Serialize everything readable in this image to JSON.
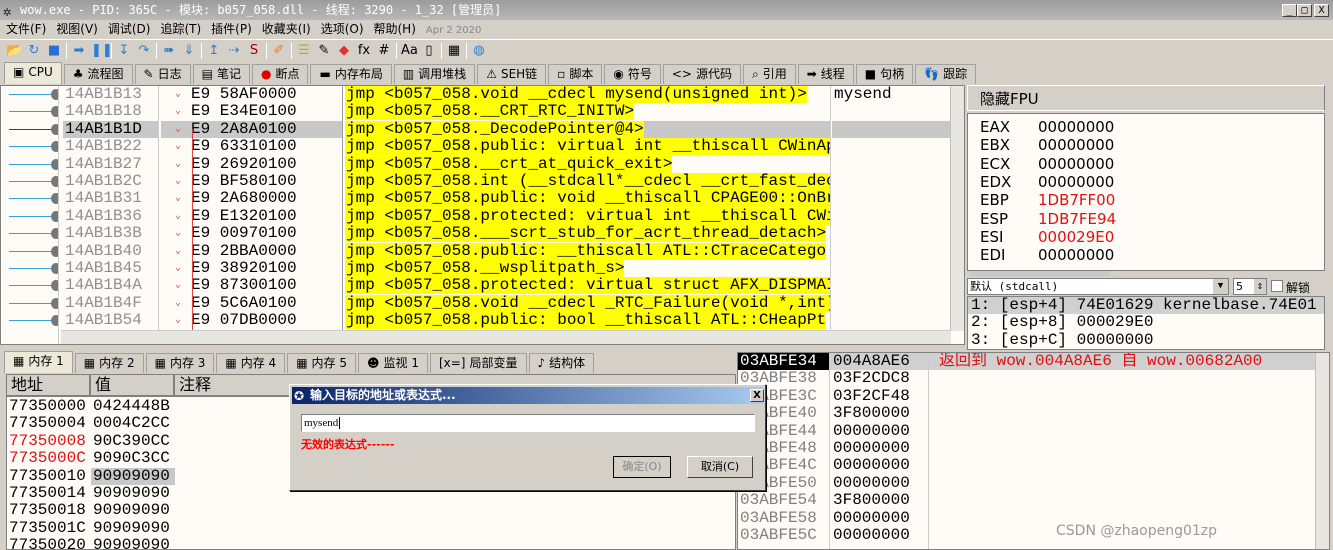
{
  "title": "wow.exe - PID: 365C - 模块: b057_058.dll - 线程: 3290 - 1_32 [管理员]",
  "window_buttons": {
    "minimize": "_",
    "maximize": "□",
    "close": "X"
  },
  "menu": [
    "文件(F)",
    "视图(V)",
    "调试(D)",
    "追踪(T)",
    "插件(P)",
    "收藏夹(I)",
    "选项(O)",
    "帮助(H)"
  ],
  "menu_date": "Apr 2 2020",
  "toolbar_icons": [
    "open-icon",
    "restart-icon",
    "stop-icon",
    "run-icon",
    "pause-icon",
    "step-into-icon",
    "step-over-icon",
    "trace-into-icon",
    "trace-over-icon",
    "execute-till-return-icon",
    "run-to-user-code-icon",
    "scylla-icon",
    "patch-icon",
    "comment-icon",
    "label-icon",
    "bookmark-icon",
    "function-icon",
    "hash-icon",
    "font-icon",
    "device-icon",
    "calculator-icon",
    "globe-icon"
  ],
  "main_tabs": [
    {
      "icon": "▣",
      "label": "CPU"
    },
    {
      "icon": "♣",
      "label": "流程图"
    },
    {
      "icon": "✎",
      "label": "日志"
    },
    {
      "icon": "▤",
      "label": "笔记"
    },
    {
      "icon": "●",
      "label": "断点"
    },
    {
      "icon": "▬",
      "label": "内存布局"
    },
    {
      "icon": "▥",
      "label": "调用堆栈"
    },
    {
      "icon": "⚠",
      "label": "SEH链"
    },
    {
      "icon": "▫",
      "label": "脚本"
    },
    {
      "icon": "◉",
      "label": "符号"
    },
    {
      "icon": "<>",
      "label": "源代码"
    },
    {
      "icon": "⌕",
      "label": "引用"
    },
    {
      "icon": "➡",
      "label": "线程"
    },
    {
      "icon": "■",
      "label": "句柄"
    },
    {
      "icon": "👣",
      "label": "跟踪"
    }
  ],
  "disasm": {
    "rows": [
      {
        "addr": "14AB1B13",
        "bytes": "E9 58AF0000",
        "instr": "jmp <b057_058.void __cdecl mysend(unsigned int)>",
        "comment": "mysend"
      },
      {
        "addr": "14AB1B18",
        "bytes": "E9 E34E0100",
        "instr": "jmp <b057_058.__CRT_RTC_INITW>",
        "comment": ""
      },
      {
        "addr": "14AB1B1D",
        "bytes": "E9 2A8A0100",
        "instr": "jmp <b057_058._DecodePointer@4>",
        "comment": "",
        "selected": true
      },
      {
        "addr": "14AB1B22",
        "bytes": "E9 63310100",
        "instr": "jmp <b057_058.public: virtual int __thiscall CWinAp",
        "comment": ""
      },
      {
        "addr": "14AB1B27",
        "bytes": "E9 26920100",
        "instr": "jmp <b057_058.__crt_at_quick_exit>",
        "comment": ""
      },
      {
        "addr": "14AB1B2C",
        "bytes": "E9 BF580100",
        "instr": "jmp <b057_058.int (__stdcall*__cdecl __crt_fast_dec",
        "comment": ""
      },
      {
        "addr": "14AB1B31",
        "bytes": "E9 2A680000",
        "instr": "jmp <b057_058.public: void __thiscall CPAGE00::OnBr",
        "comment": ""
      },
      {
        "addr": "14AB1B36",
        "bytes": "E9 E1320100",
        "instr": "jmp <b057_058.protected: virtual int __thiscall CWi",
        "comment": ""
      },
      {
        "addr": "14AB1B3B",
        "bytes": "E9 00970100",
        "instr": "jmp <b057_058.___scrt_stub_for_acrt_thread_detach>",
        "comment": ""
      },
      {
        "addr": "14AB1B40",
        "bytes": "E9 2BBA0000",
        "instr": "jmp <b057_058.public: __thiscall ATL::CTraceCatego",
        "comment": ""
      },
      {
        "addr": "14AB1B45",
        "bytes": "E9 38920100",
        "instr": "jmp <b057_058.__wsplitpath_s>",
        "comment": ""
      },
      {
        "addr": "14AB1B4A",
        "bytes": "E9 87300100",
        "instr": "jmp <b057_058.protected: virtual struct AFX_DISPMAI",
        "comment": ""
      },
      {
        "addr": "14AB1B4F",
        "bytes": "E9 5C6A0100",
        "instr": "jmp <b057_058.void __cdecl _RTC_Failure(void *,int)",
        "comment": ""
      },
      {
        "addr": "14AB1B54",
        "bytes": "E9 07DB0000",
        "instr": "jmp <b057_058.public: bool __thiscall ATL::CHeapPt",
        "comment": ""
      }
    ]
  },
  "registers": {
    "header": "隐藏FPU",
    "items": [
      {
        "name": "EAX",
        "value": "00000000",
        "changed": false
      },
      {
        "name": "EBX",
        "value": "00000000",
        "changed": false
      },
      {
        "name": "ECX",
        "value": "00000000",
        "changed": false
      },
      {
        "name": "EDX",
        "value": "00000000",
        "changed": false
      },
      {
        "name": "EBP",
        "value": "1DB7FF00",
        "changed": true
      },
      {
        "name": "ESP",
        "value": "1DB7FE94",
        "changed": true
      },
      {
        "name": "ESI",
        "value": "000029E0",
        "changed": true
      },
      {
        "name": "EDI",
        "value": "00000000",
        "changed": false
      }
    ]
  },
  "callconv": {
    "selected": "默认 (stdcall)",
    "count": "5",
    "unlock_label": "解锁"
  },
  "stack_args": [
    "1: [esp+4] 74E01629 kernelbase.74E01",
    "2: [esp+8] 000029E0",
    "3: [esp+C] 00000000"
  ],
  "bottom_tabs": [
    {
      "icon": "▦",
      "label": "内存 1"
    },
    {
      "icon": "▦",
      "label": "内存 2"
    },
    {
      "icon": "▦",
      "label": "内存 3"
    },
    {
      "icon": "▦",
      "label": "内存 4"
    },
    {
      "icon": "▦",
      "label": "内存 5"
    },
    {
      "icon": "☻",
      "label": "监视 1"
    },
    {
      "icon": "[x=]",
      "label": "局部变量"
    },
    {
      "icon": "♪",
      "label": "结构体"
    }
  ],
  "dump": {
    "headers": {
      "address": "地址",
      "value": "值",
      "comment": "注释"
    },
    "rows": [
      {
        "addr": "77350000",
        "value": "0424448B"
      },
      {
        "addr": "77350004",
        "value": "0004C2CC"
      },
      {
        "addr": "77350008",
        "value": "90C390CC",
        "red": true
      },
      {
        "addr": "7735000C",
        "value": "9090C3CC",
        "red": true
      },
      {
        "addr": "77350010",
        "value": "90909090",
        "selected": true
      },
      {
        "addr": "77350014",
        "value": "90909090"
      },
      {
        "addr": "77350018",
        "value": "90909090"
      },
      {
        "addr": "7735001C",
        "value": "90909090"
      },
      {
        "addr": "77350020",
        "value": "90909090"
      }
    ]
  },
  "stack": {
    "rows": [
      {
        "addr": "03ABFE34",
        "value": "004A8AE6",
        "comment": "返回到 wow.004A8AE6 自 wow.00682A00",
        "current": true
      },
      {
        "addr": "03ABFE38",
        "value": "03F2CDC8",
        "comment": ""
      },
      {
        "addr": "03ABFE3C",
        "value": "03F2CF48",
        "comment": ""
      },
      {
        "addr": "03ABFE40",
        "value": "3F800000",
        "comment": ""
      },
      {
        "addr": "03ABFE44",
        "value": "00000000",
        "comment": ""
      },
      {
        "addr": "03ABFE48",
        "value": "00000000",
        "comment": ""
      },
      {
        "addr": "03ABFE4C",
        "value": "00000000",
        "comment": ""
      },
      {
        "addr": "03ABFE50",
        "value": "00000000",
        "comment": ""
      },
      {
        "addr": "03ABFE54",
        "value": "3F800000",
        "comment": ""
      },
      {
        "addr": "03ABFE58",
        "value": "00000000",
        "comment": ""
      },
      {
        "addr": "03ABFE5C",
        "value": "00000000",
        "comment": ""
      }
    ]
  },
  "dialog": {
    "title": "输入目标的地址或表达式...",
    "input_value": "mysend",
    "error": "无效的表达式------",
    "ok_label": "确定(O)",
    "cancel_label": "取消(C)",
    "close": "X"
  },
  "watermark": "CSDN @zhaopeng01zp",
  "colors": {
    "highlight": "#ffff00",
    "changed": "#e01010",
    "selection": "#c8c8c8"
  }
}
